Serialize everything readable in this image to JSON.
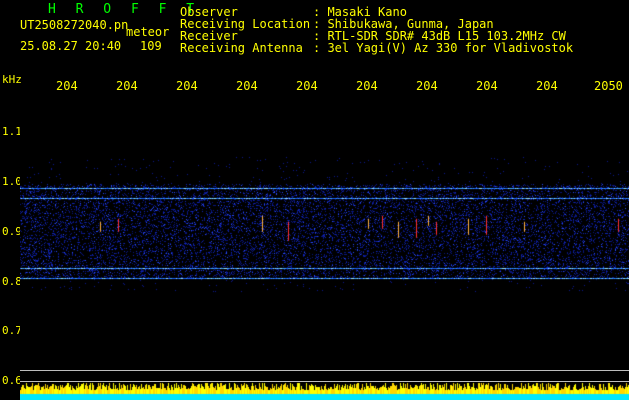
{
  "header": {
    "app_title": "H R O F F T",
    "file_name": "UT2508272040.pn",
    "meteor_label": "meteor",
    "date_time": "25.08.27 20:40",
    "meteor_count": "109"
  },
  "station_info": [
    {
      "label": "Observer",
      "value": ": Masaki Kano"
    },
    {
      "label": "Receiving Location",
      "value": ": Shibukawa, Gunma, Japan"
    },
    {
      "label": "Receiver",
      "value": ": RTL-SDR SDR# 43dB L15 103.2MHz CW"
    },
    {
      "label": "Receiving Antenna",
      "value": ": 3el Yagi(V) Az 330 for Vladivostok"
    }
  ],
  "axes": {
    "y_unit": "kHz",
    "y_labels": [
      "1.1",
      "1.0",
      "0.9",
      "0.8",
      "0.7",
      "0.6"
    ],
    "x_labels": [
      "204",
      "204",
      "204",
      "204",
      "204",
      "204",
      "204",
      "204",
      "204",
      "2050"
    ]
  },
  "colors": {
    "background": "#000000",
    "header_text": "#ffff00",
    "info_text": "#ffffff",
    "title_text": "#00ff00",
    "noise_band": "#0a1a8c",
    "meteor_echo": "#ff3030"
  },
  "spectrogram": {
    "band_top_khz": 0.995,
    "band_bottom_khz": 0.805,
    "carrier_lines_khz": [
      0.987,
      0.968,
      0.828,
      0.808
    ],
    "frequency_range_khz": [
      0.58,
      1.2
    ]
  }
}
